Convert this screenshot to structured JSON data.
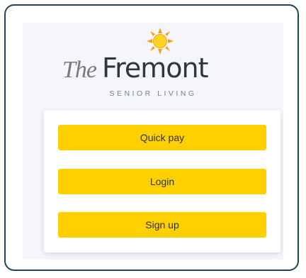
{
  "logo": {
    "the_text": "The",
    "name_text": "Fremont",
    "tagline": "SENIOR LIVING",
    "sun_colors": {
      "rays": "#f7a21b",
      "core": "#ffd21f"
    }
  },
  "actions": {
    "quick_pay_label": "Quick pay",
    "login_label": "Login",
    "sign_up_label": "Sign up"
  },
  "colors": {
    "frame_border": "#1d4658",
    "panel_bg": "#f4f6f9",
    "button_bg": "#ffd000",
    "brand_text": "#2f3640"
  }
}
